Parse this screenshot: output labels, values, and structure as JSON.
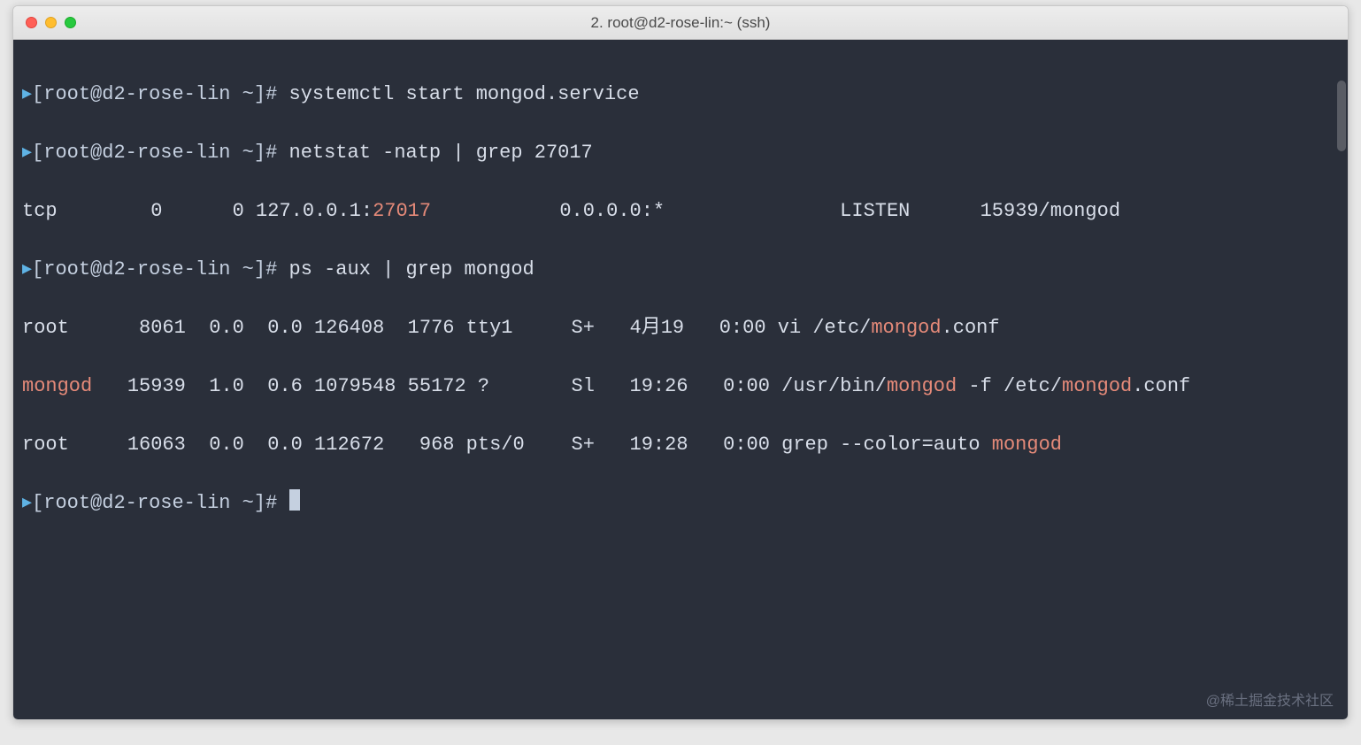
{
  "window": {
    "title": "2. root@d2-rose-lin:~ (ssh)"
  },
  "lines": {
    "l1_arrow": "▸",
    "l1_prompt": "[root@d2-rose-lin ~]# ",
    "l1_cmd": "systemctl start mongod.service",
    "l2_arrow": "▸",
    "l2_prompt": "[root@d2-rose-lin ~]# ",
    "l2_cmd": "netstat -natp | grep 27017",
    "l3_a": "tcp        0      0 127.0.0.1:",
    "l3_hl": "27017",
    "l3_b": "           0.0.0.0:*               LISTEN      15939/mongod",
    "l4_arrow": "▸",
    "l4_prompt": "[root@d2-rose-lin ~]# ",
    "l4_cmd": "ps -aux | grep mongod",
    "l5_a": "root      8061  0.0  0.0 126408  1776 tty1     S+   4月19   0:00 vi /etc/",
    "l5_hl": "mongod",
    "l5_b": ".conf",
    "l6_hl1": "mongod",
    "l6_a": "   15939  1.0  0.6 1079548 55172 ?       Sl   19:26   0:00 /usr/bin/",
    "l6_hl2": "mongod",
    "l6_b": " -f /etc/",
    "l6_hl3": "mongod",
    "l6_c": ".conf",
    "l7_a": "root     16063  0.0  0.0 112672   968 pts/0    S+   19:28   0:00 grep --color=auto ",
    "l7_hl": "mongod",
    "l8_arrow": "▸",
    "l8_prompt": "[root@d2-rose-lin ~]# "
  },
  "watermark": "@稀土掘金技术社区"
}
